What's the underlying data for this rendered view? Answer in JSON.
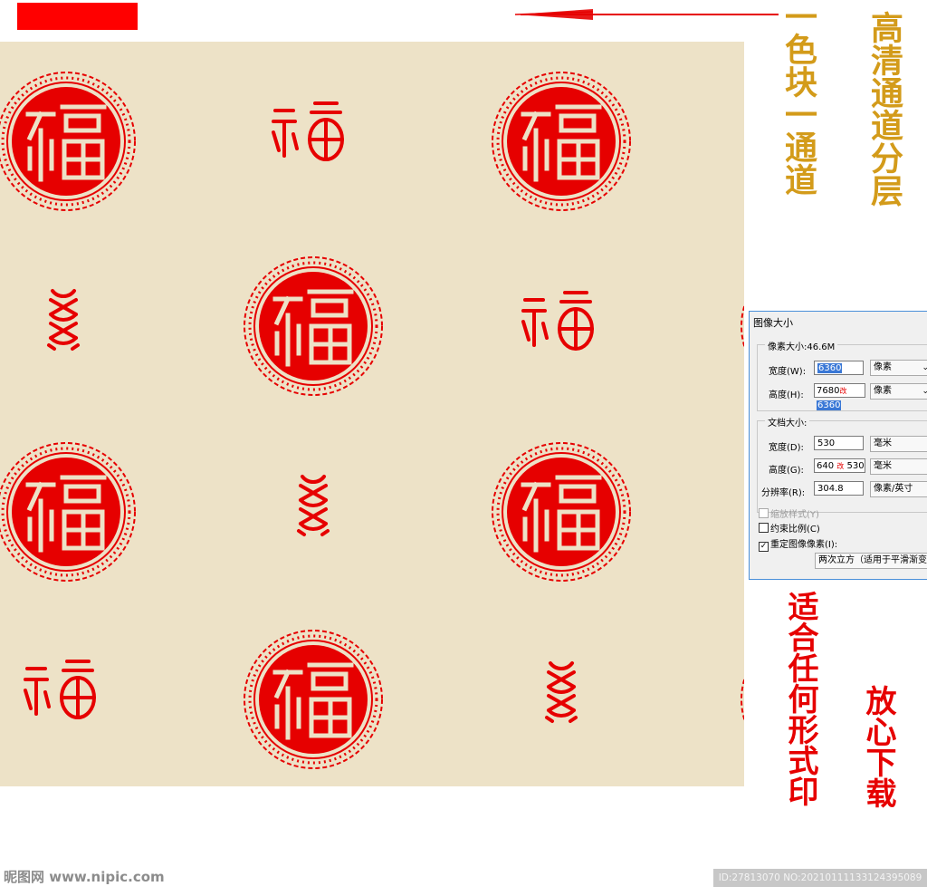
{
  "colors": {
    "background": "#ffffff",
    "pattern_background": "#ede2c7",
    "seal_red": "#e60000",
    "gold_text": "#d39b1a"
  },
  "annotations": {
    "left_vertical": "一色块一通道",
    "right_vertical": "高清通道分层",
    "bottom_left_vertical": "适合任何形式印",
    "bottom_right_vertical": "放心下载"
  },
  "dialog": {
    "title": "图像大小",
    "pixel_group_legend": "像素大小:46.6M",
    "width_label": "宽度(W):",
    "width_value": "6360",
    "height_label": "高度(H):",
    "height_value_prefix": "7680",
    "height_value_alt": "改",
    "height_value": "6360",
    "pixel_unit": "像素",
    "doc_group_legend": "文档大小:",
    "doc_width_label": "宽度(D):",
    "doc_width_value": "530",
    "doc_height_label": "高度(G):",
    "doc_height_prefix": "640",
    "doc_height_alt": "改",
    "doc_height_value": "530",
    "mm_unit": "毫米",
    "resolution_label": "分辨率(R):",
    "resolution_value": "304.8",
    "resolution_unit": "像素/英寸",
    "scale_styles": "缩放样式(Y)",
    "constrain_proportions": "约束比例(C)",
    "resample": "重定图像像素(I):",
    "resample_method": "两次立方（适用于平滑渐变"
  },
  "watermark": {
    "left": "昵图网 www.nipic.com",
    "right": "ID:27813070 NO:20210111133124395089"
  }
}
